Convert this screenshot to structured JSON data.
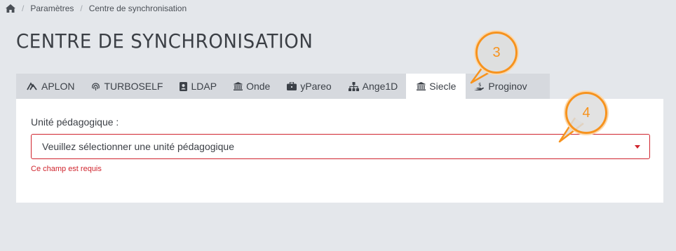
{
  "breadcrumb": {
    "home_icon": "home-icon",
    "items": [
      "Paramètres",
      "Centre de synchronisation"
    ],
    "separator": "/"
  },
  "page_title": "CENTRE DE SYNCHRONISATION",
  "tabs": [
    {
      "label": "APLON",
      "icon": "aplon-icon",
      "active": false
    },
    {
      "label": "TURBOSELF",
      "icon": "fingerprint-icon",
      "active": false
    },
    {
      "label": "LDAP",
      "icon": "address-book-icon",
      "active": false
    },
    {
      "label": "Onde",
      "icon": "institution-icon",
      "active": false
    },
    {
      "label": "yPareo",
      "icon": "briefcase-icon",
      "active": false
    },
    {
      "label": "Ange1D",
      "icon": "sitemap-icon",
      "active": false
    },
    {
      "label": "Siecle",
      "icon": "institution-icon",
      "active": true
    },
    {
      "label": "Proginov",
      "icon": "hand-money-icon",
      "active": false
    }
  ],
  "form": {
    "label": "Unité pédagogique :",
    "select_value": "Veuillez sélectionner une unité pédagogique",
    "error": "Ce champ est requis"
  },
  "callouts": [
    "3",
    "4"
  ],
  "colors": {
    "background": "#e4e7eb",
    "tab_bar": "#d6d9de",
    "error_red": "#d0252e",
    "callout_orange": "#f7931e"
  }
}
